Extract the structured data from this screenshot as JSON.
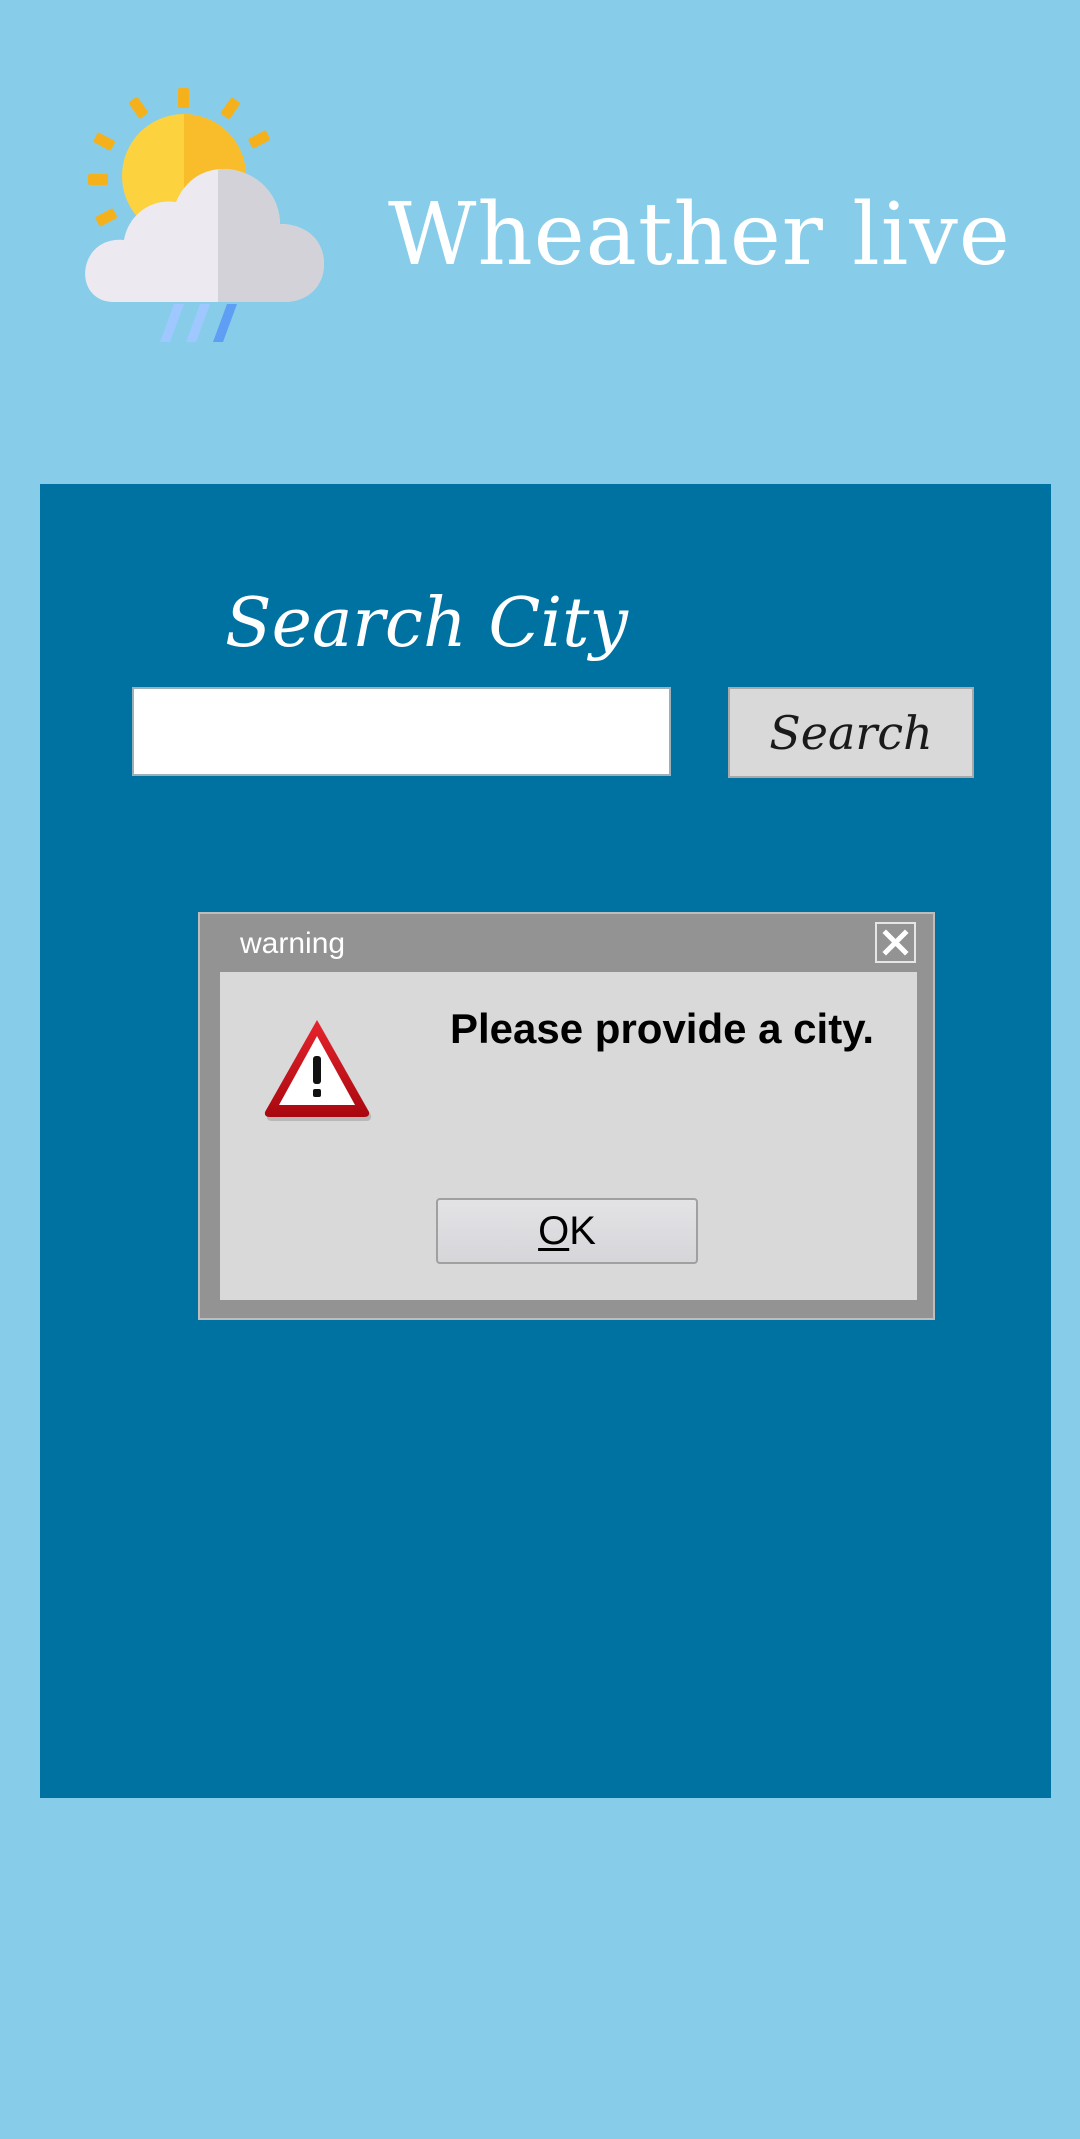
{
  "app": {
    "title": "Wheather live",
    "logo_icon": "weather-sun-cloud-rain-icon"
  },
  "search": {
    "label": "Search City",
    "input_value": "",
    "placeholder": "",
    "button_label": "Search"
  },
  "dialog": {
    "title": "warning",
    "message": "Please provide a city.",
    "ok_label_mnemonic": "O",
    "ok_label_rest": "K",
    "close_icon": "close-icon",
    "warning_icon": "warning-triangle-icon"
  },
  "colors": {
    "background": "#87cdea",
    "panel": "#0072a1",
    "dialog_frame": "#939393",
    "dialog_body": "#d9d9d9",
    "warning_red": "#d0101b"
  }
}
